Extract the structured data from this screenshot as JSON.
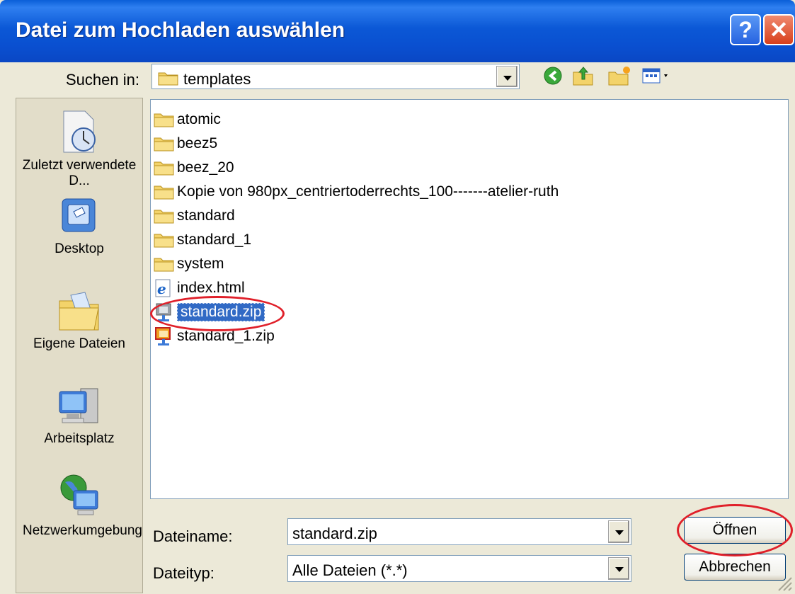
{
  "dialog": {
    "title": "Datei zum Hochladen auswählen",
    "help_label": "?",
    "close_label": "✕"
  },
  "look_in": {
    "label": "Suchen in:",
    "value": "templates"
  },
  "places": [
    {
      "label": "Zuletzt verwendete D...",
      "icon": "recent-documents-icon"
    },
    {
      "label": "Desktop",
      "icon": "desktop-icon"
    },
    {
      "label": "Eigene Dateien",
      "icon": "my-documents-icon"
    },
    {
      "label": "Arbeitsplatz",
      "icon": "my-computer-icon"
    },
    {
      "label": "Netzwerkumgebung",
      "icon": "network-places-icon"
    }
  ],
  "files": [
    {
      "name": "atomic",
      "type": "folder"
    },
    {
      "name": "beez5",
      "type": "folder"
    },
    {
      "name": "beez_20",
      "type": "folder"
    },
    {
      "name": "Kopie von 980px_centriertoderrechts_100-------atelier-ruth",
      "type": "folder"
    },
    {
      "name": "standard",
      "type": "folder"
    },
    {
      "name": "standard_1",
      "type": "folder"
    },
    {
      "name": "system",
      "type": "folder"
    },
    {
      "name": "index.html",
      "type": "html"
    },
    {
      "name": "standard.zip",
      "type": "zip",
      "selected": true
    },
    {
      "name": "standard_1.zip",
      "type": "zip"
    }
  ],
  "filename": {
    "label": "Dateiname:",
    "value": "standard.zip"
  },
  "filetype": {
    "label": "Dateityp:",
    "value": "Alle Dateien (*.*)"
  },
  "buttons": {
    "open": "Öffnen",
    "cancel": "Abbrechen"
  },
  "colors": {
    "titlebar": "#0a4fd0",
    "selection": "#316ac5",
    "highlight_ring": "#e0202a"
  }
}
